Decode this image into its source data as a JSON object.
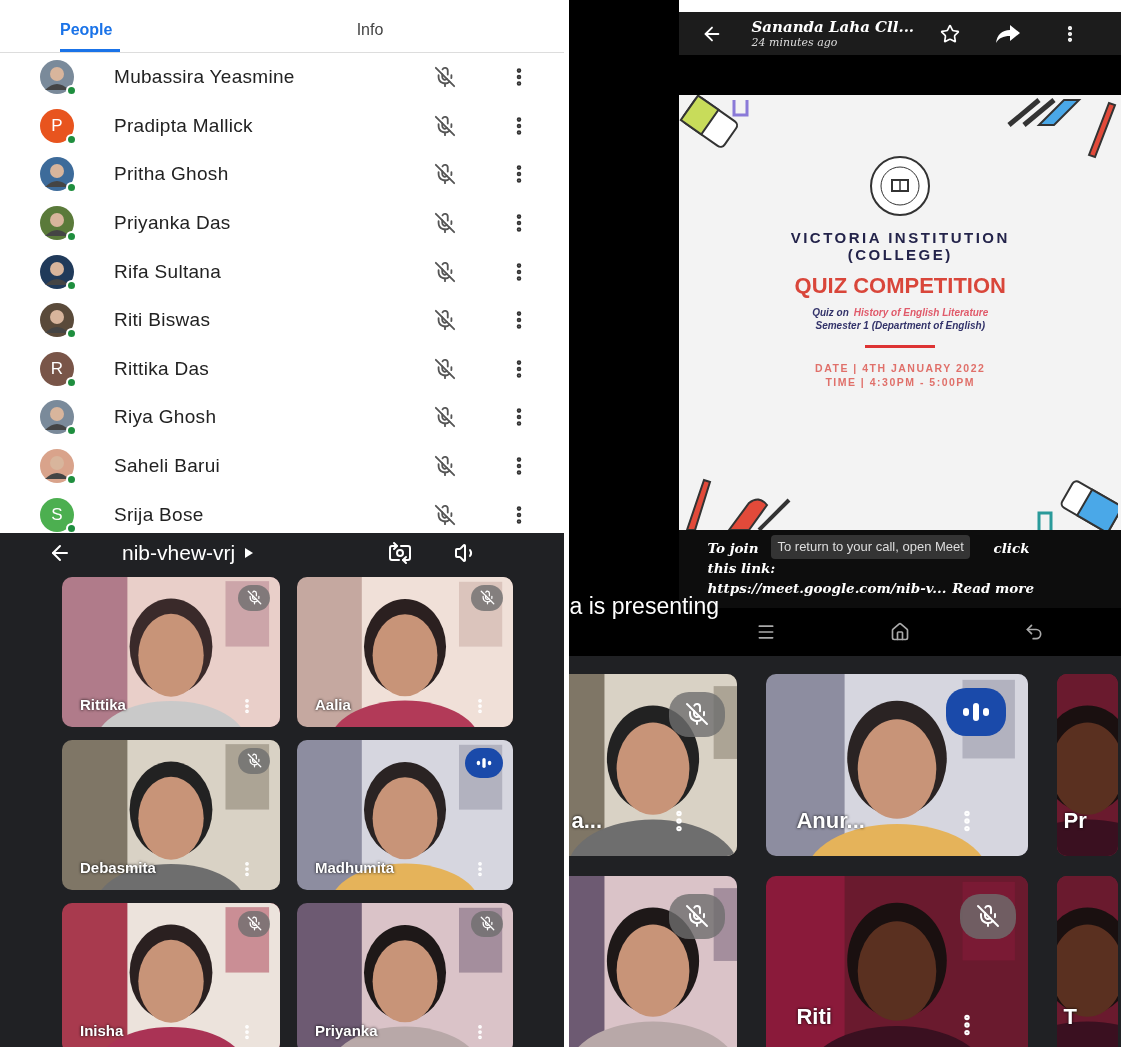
{
  "people_panel": {
    "tabs": [
      {
        "label": "People",
        "selected": true
      },
      {
        "label": "Info",
        "selected": false
      }
    ],
    "participants": [
      {
        "name": "Mubassira Yeasmine"
      },
      {
        "name": "Pradipta Mallick",
        "avatar": {
          "kind": "letter",
          "letter": "P",
          "color": "#e8541e"
        }
      },
      {
        "name": "Pritha Ghosh"
      },
      {
        "name": "Priyanka Das"
      },
      {
        "name": "Rifa Sultana"
      },
      {
        "name": "Riti Biswas"
      },
      {
        "name": "Rittika Das",
        "avatar": {
          "kind": "letter",
          "letter": "R",
          "color": "#795548"
        }
      },
      {
        "name": "Riya Ghosh"
      },
      {
        "name": "Saheli Barui"
      },
      {
        "name": "Srija Bose",
        "avatar": {
          "kind": "letter",
          "letter": "S",
          "color": "#4caf50"
        }
      }
    ]
  },
  "meet_call": {
    "meeting_code": "nib-vhew-vrj",
    "tiles": [
      {
        "name": "Rittika",
        "muted": true,
        "speaking": false
      },
      {
        "name": "Aalia",
        "muted": true,
        "speaking": false
      },
      {
        "name": "Debasmita",
        "muted": true,
        "speaking": false
      },
      {
        "name": "Madhumita",
        "muted": false,
        "speaking": true
      },
      {
        "name": "Inisha",
        "muted": true,
        "speaking": false
      },
      {
        "name": "Priyanka",
        "muted": true,
        "speaking": false
      }
    ]
  },
  "shared_post": {
    "title": "Sananda Laha Cll...",
    "time": "24 minutes ago",
    "slide": {
      "institution": "VICTORIA INSTITUTION",
      "institution_sub": "(COLLEGE)",
      "heading": "QUIZ COMPETITION",
      "topic_prefix": "Quiz on",
      "topic": "History of English Literature",
      "semester": "Semester 1 (Department of English)",
      "date": "DATE | 4TH JANUARY 2022",
      "time": "TIME | 4:30PM - 5:00PM"
    },
    "caption": {
      "line_1_start": "To join",
      "line_1_end": "click",
      "line_2": "this link:",
      "link": "https://meet.google.com/nib-v...",
      "read_more": "Read more"
    },
    "toast": "To return to your call, open Meet",
    "presenting": "a is presenting"
  },
  "presenter_grid": {
    "tiles": [
      {
        "name": "a...",
        "muted": true,
        "speaking": false,
        "menu": true
      },
      {
        "name": "Anur...",
        "muted": false,
        "speaking": true,
        "menu": true
      },
      {
        "name": "Pr",
        "muted": false,
        "speaking": false,
        "menu": false
      },
      {
        "muted": true,
        "speaking": false,
        "menu": false
      },
      {
        "name": "Riti",
        "muted": true,
        "speaking": false,
        "menu": true
      },
      {
        "name": "T",
        "muted": false,
        "speaking": false,
        "menu": false
      }
    ]
  }
}
